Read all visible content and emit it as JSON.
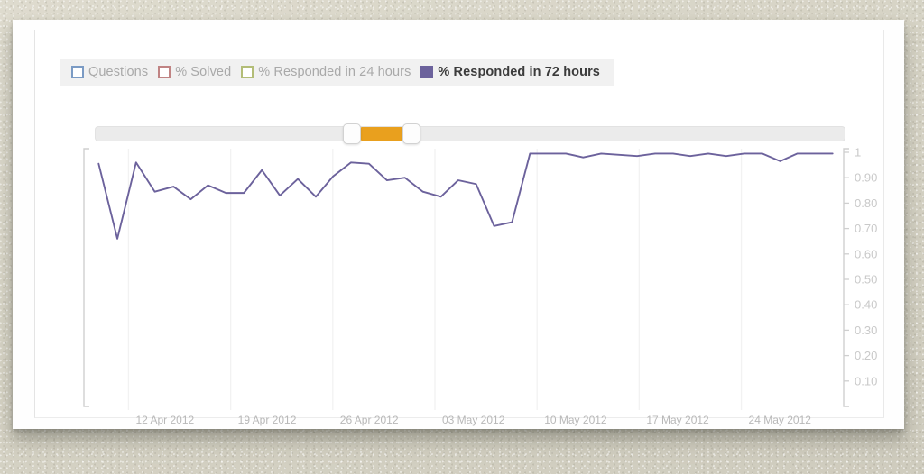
{
  "legend": {
    "items": [
      {
        "label": "Questions",
        "color": "#7b9bc4",
        "active": false,
        "icon": "legend-swatch-icon"
      },
      {
        "label": "% Solved",
        "color": "#c08383",
        "active": false,
        "icon": "legend-swatch-icon"
      },
      {
        "label": "% Responded in 24 hours",
        "color": "#b3bd77",
        "active": false,
        "icon": "legend-swatch-icon"
      },
      {
        "label": "% Responded in 72 hours",
        "color": "#6c629c",
        "active": true,
        "icon": "legend-swatch-icon"
      }
    ]
  },
  "slider": {
    "left_handle_pct": 35.5,
    "right_handle_pct": 41.0,
    "track_color": "#ebebeb",
    "range_color": "#e9a01e",
    "handle_color": "#fdfdfd"
  },
  "chart_data": {
    "type": "line",
    "title": "",
    "xlabel": "",
    "ylabel": "",
    "ylim": [
      0,
      1
    ],
    "grid": true,
    "legend_position": "top-left",
    "y_ticks": [
      "1",
      "0.90",
      "0.80",
      "0.70",
      "0.60",
      "0.50",
      "0.40",
      "0.30",
      "0.20",
      "0.10"
    ],
    "y_tick_values": [
      1,
      0.9,
      0.8,
      0.7,
      0.6,
      0.5,
      0.4,
      0.3,
      0.2,
      0.1
    ],
    "x_ticks": [
      "12 Apr 2012",
      "19 Apr 2012",
      "26 Apr 2012",
      "03 May 2012",
      "10 May 2012",
      "17 May 2012",
      "24 May 2012"
    ],
    "x_tick_positions": [
      0.0909,
      0.2273,
      0.3636,
      0.5,
      0.6364,
      0.7727,
      0.9091
    ],
    "series": [
      {
        "name": "% Responded in 72 hours",
        "color": "#6c629c",
        "x": [
          0.01,
          0.035,
          0.06,
          0.085,
          0.11,
          0.133,
          0.156,
          0.18,
          0.204,
          0.228,
          0.252,
          0.276,
          0.3,
          0.323,
          0.347,
          0.371,
          0.395,
          0.419,
          0.443,
          0.467,
          0.49,
          0.514,
          0.538,
          0.562,
          0.586,
          0.61,
          0.634,
          0.657,
          0.681,
          0.705,
          0.729,
          0.753,
          0.777,
          0.8,
          0.824,
          0.848,
          0.872,
          0.896,
          0.92,
          0.943,
          0.967,
          0.99
        ],
        "values": [
          0.955,
          0.66,
          0.96,
          0.845,
          0.865,
          0.815,
          0.87,
          0.84,
          0.84,
          0.93,
          0.83,
          0.895,
          0.825,
          0.905,
          0.96,
          0.955,
          0.89,
          0.9,
          0.845,
          0.825,
          0.89,
          0.875,
          0.71,
          0.725,
          0.995,
          0.995,
          0.995,
          0.98,
          0.995,
          0.99,
          0.985,
          0.995,
          0.995,
          0.985,
          0.995,
          0.985,
          0.995,
          0.995,
          0.965,
          0.995,
          0.995,
          0.995
        ]
      }
    ]
  }
}
